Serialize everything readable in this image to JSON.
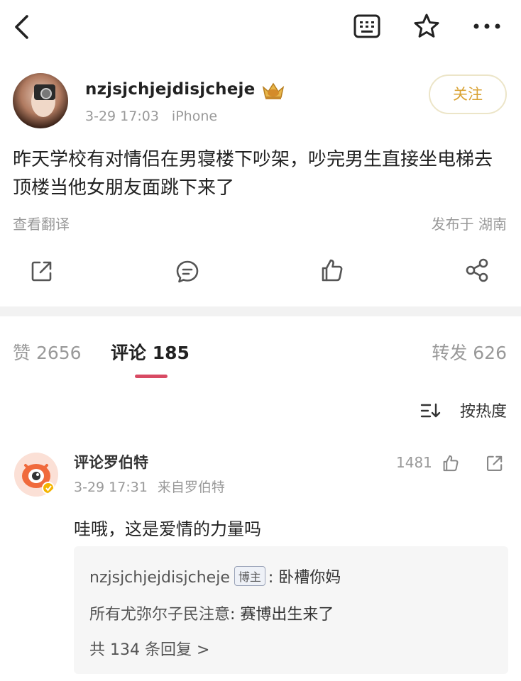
{
  "topbar": {
    "back_icon": "chevron-left-icon",
    "list_icon": "keyboard-list-icon",
    "favorite_icon": "star-icon",
    "more_icon": "more-dots-icon"
  },
  "post": {
    "username": "nzjsjchjejdisjcheje",
    "date": "3-29 17:03",
    "device": "iPhone",
    "follow_label": "关注",
    "text": "昨天学校有对情侣在男寝楼下吵架，吵完男生直接坐电梯去顶楼当他女朋友面跳下来了",
    "translate_label": "查看翻译",
    "location": "发布于 湖南"
  },
  "tabs": {
    "likes": "赞 2656",
    "comments": "评论 185",
    "reposts": "转发 626"
  },
  "sort": {
    "label": "按热度"
  },
  "comment": {
    "name": "评论罗伯特",
    "date": "3-29 17:31",
    "source": "来自罗伯特",
    "likes": "1481",
    "text": "哇哦，这是爱情的力量吗",
    "replies": [
      {
        "user": "nzjsjchjejdisjcheje",
        "badge": "博主",
        "text": ": 卧槽你妈"
      },
      {
        "user": "所有尤弥尔子民注意",
        "text": ": 赛博出生来了"
      }
    ],
    "reply_count": "共 134 条回复 >"
  },
  "colors": {
    "accent": "#d84a63",
    "follow": "#d9a233",
    "muted": "#999999"
  }
}
